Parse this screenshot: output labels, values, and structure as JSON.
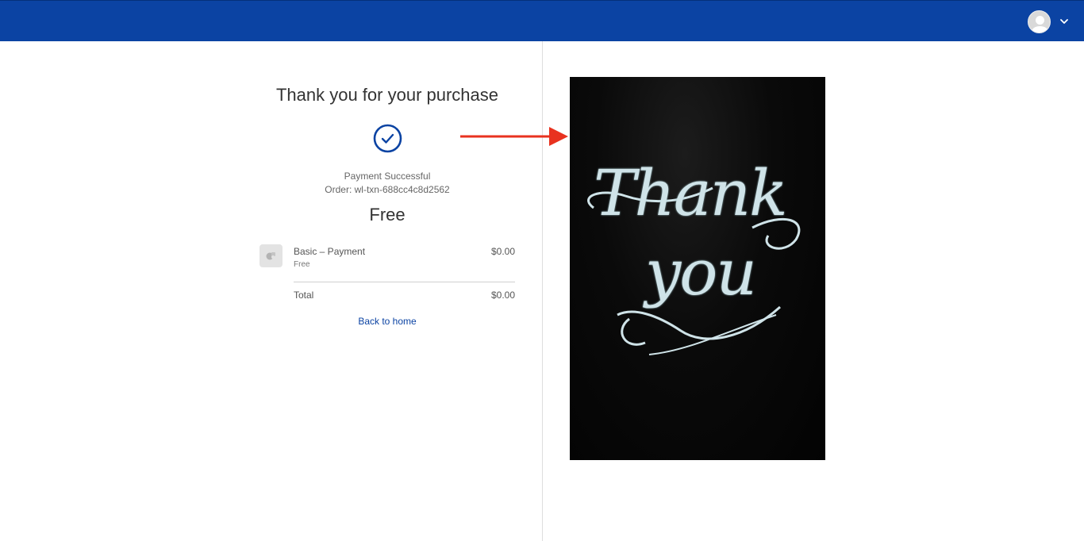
{
  "colors": {
    "topbar": "#0b43a3",
    "accent": "#0b43a3",
    "annotation_arrow": "#e8321f",
    "card_background": "#050505",
    "card_lettering": "#cfe3e8"
  },
  "header": {
    "avatar_icon": "user-avatar-icon",
    "menu_icon": "chevron-down-icon"
  },
  "confirmation": {
    "title": "Thank you for your purchase",
    "status_icon": "check-circle-icon",
    "status": "Payment Successful",
    "order_label": "Order:",
    "order_id": "wl-txn-688cc4c8d2562",
    "price": "Free"
  },
  "line_item": {
    "thumb_icon": "product-placeholder-icon",
    "name": "Basic – Payment",
    "sub": "Free",
    "price": "$0.00"
  },
  "totals": {
    "label": "Total",
    "value": "$0.00"
  },
  "back_link": "Back to home",
  "thank_you_card": {
    "line1": "Thank",
    "line2": "you"
  }
}
